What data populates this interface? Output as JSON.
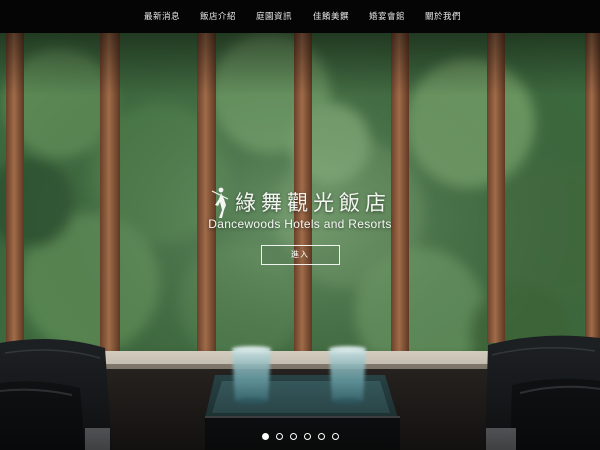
{
  "nav": {
    "items": [
      {
        "label": "最新消息"
      },
      {
        "label": "飯店介紹"
      },
      {
        "label": "庭園資訊"
      },
      {
        "label": "佳餚美饌"
      },
      {
        "label": "婚宴會館"
      },
      {
        "label": "關於我們"
      }
    ]
  },
  "brand": {
    "name_zh": "綠舞觀光飯店",
    "name_en": "Dancewoods Hotels and Resorts"
  },
  "enter_button": {
    "label": "進入"
  },
  "slider": {
    "count": 6,
    "active_index": 0
  },
  "colors": {
    "nav_bg": "#050505",
    "nav_text": "#e9e9e9",
    "foliage": "#4e7a4c",
    "post_wood": "#8a5a3c"
  }
}
